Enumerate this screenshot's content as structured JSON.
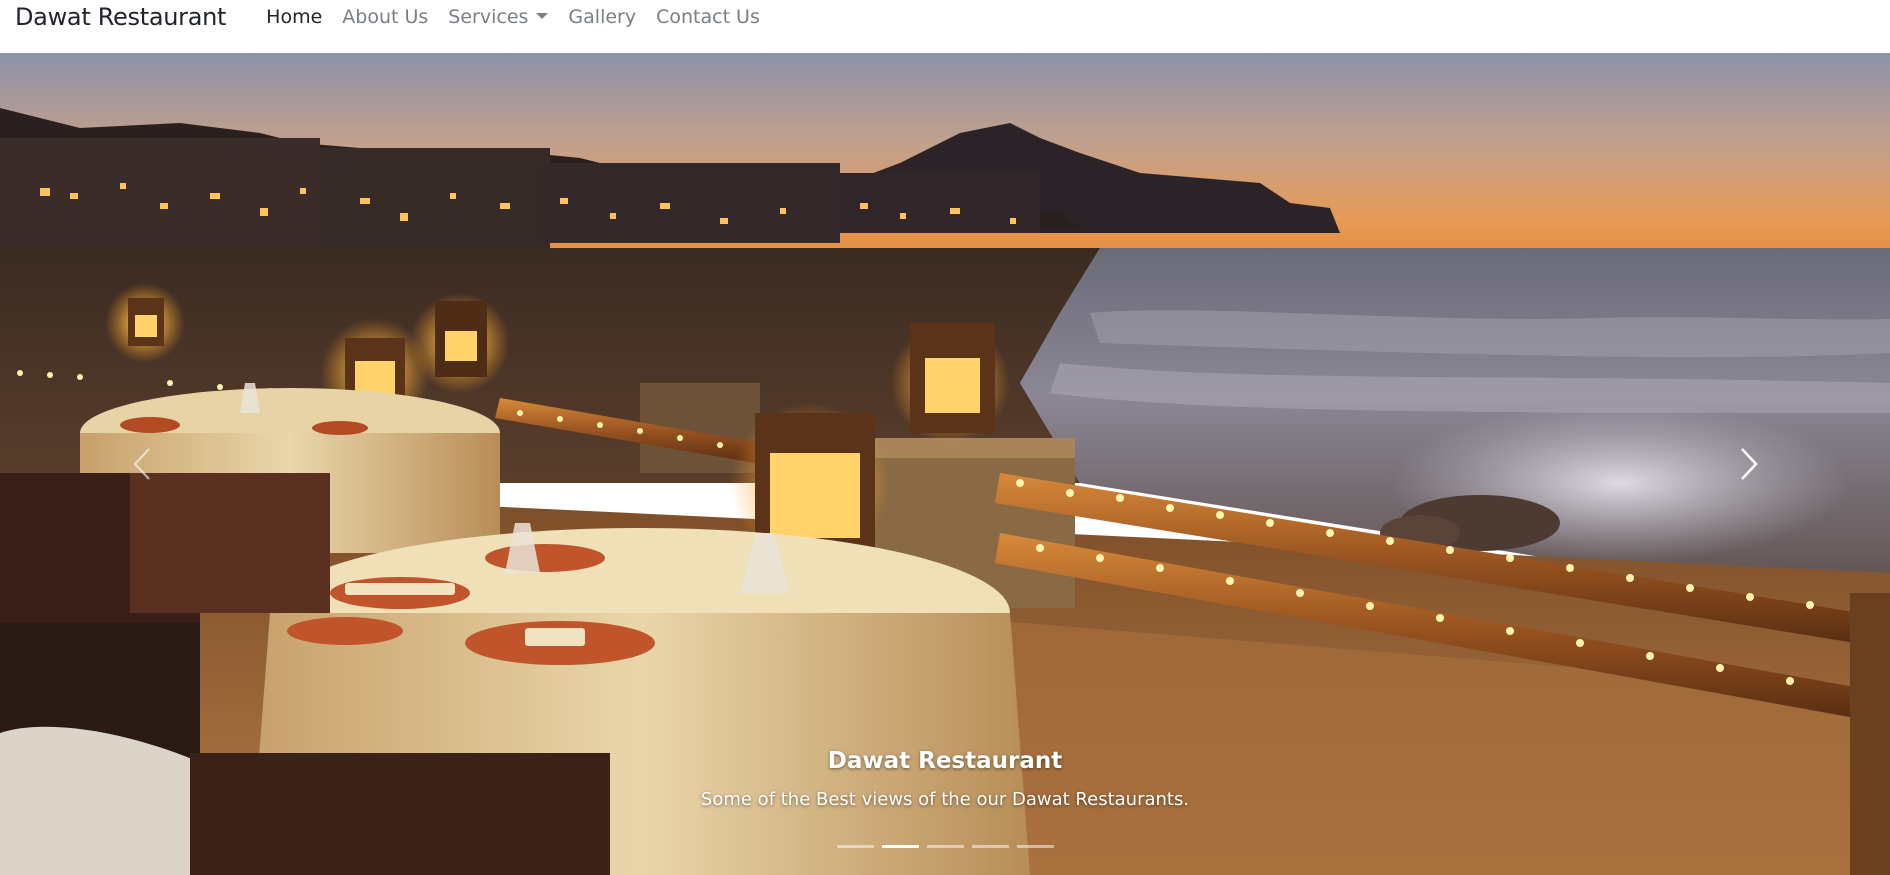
{
  "navbar": {
    "brand": "Dawat Restaurant",
    "items": [
      {
        "label": "Home",
        "active": true
      },
      {
        "label": "About Us"
      },
      {
        "label": "Services",
        "dropdown": true
      },
      {
        "label": "Gallery"
      },
      {
        "label": "Contact Us"
      }
    ]
  },
  "carousel": {
    "caption_title": "Dawat Restaurant",
    "caption_text": "Some of the Best views of the our Dawat Restaurants.",
    "prev_icon": "chevron-left-icon",
    "next_icon": "chevron-right-icon",
    "slide_count": 5,
    "active_index": 1
  },
  "colors": {
    "nav_text": "#7a7f84",
    "nav_active": "#212529",
    "caption": "#ffffff"
  }
}
